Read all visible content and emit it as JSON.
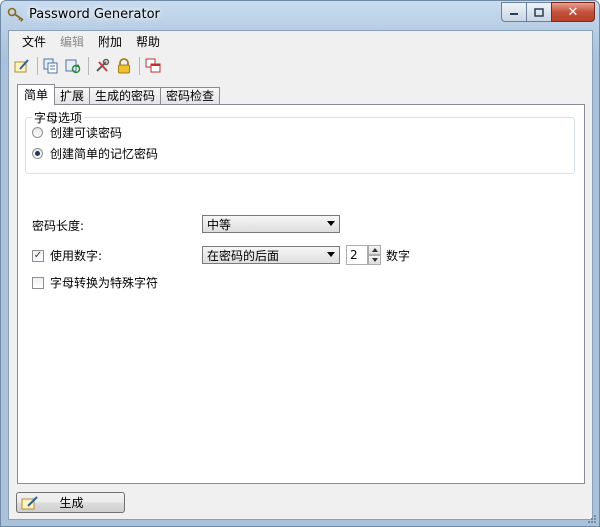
{
  "window": {
    "title": "Password Generator",
    "close_glyph": "✕"
  },
  "menu": {
    "items": [
      "文件",
      "编辑",
      "附加",
      "帮助"
    ]
  },
  "toolbar": {
    "icons": [
      "edit-icon",
      "copy-icon",
      "refresh-icon",
      "tools-icon",
      "lock-icon",
      "windows-icon"
    ]
  },
  "tabs": [
    "简单",
    "扩展",
    "生成的密码",
    "密码检查"
  ],
  "letter_options": {
    "group_label": "字母选项",
    "options": [
      "创建可读密码",
      "创建简单的记忆密码"
    ],
    "selected_index": 1
  },
  "length": {
    "label": "密码长度:",
    "value": "中等"
  },
  "digits": {
    "label": "使用数字:",
    "checked": true,
    "check_mark": "✓",
    "position_value": "在密码的后面",
    "count": "2",
    "unit": "数字"
  },
  "special": {
    "label": "字母转换为特殊字符",
    "checked": false
  },
  "generate_button": {
    "label": "生成"
  },
  "colors": {
    "close_button": "#c4523c",
    "panel_bg": "#ffffff",
    "frame": "#a9c1da"
  }
}
